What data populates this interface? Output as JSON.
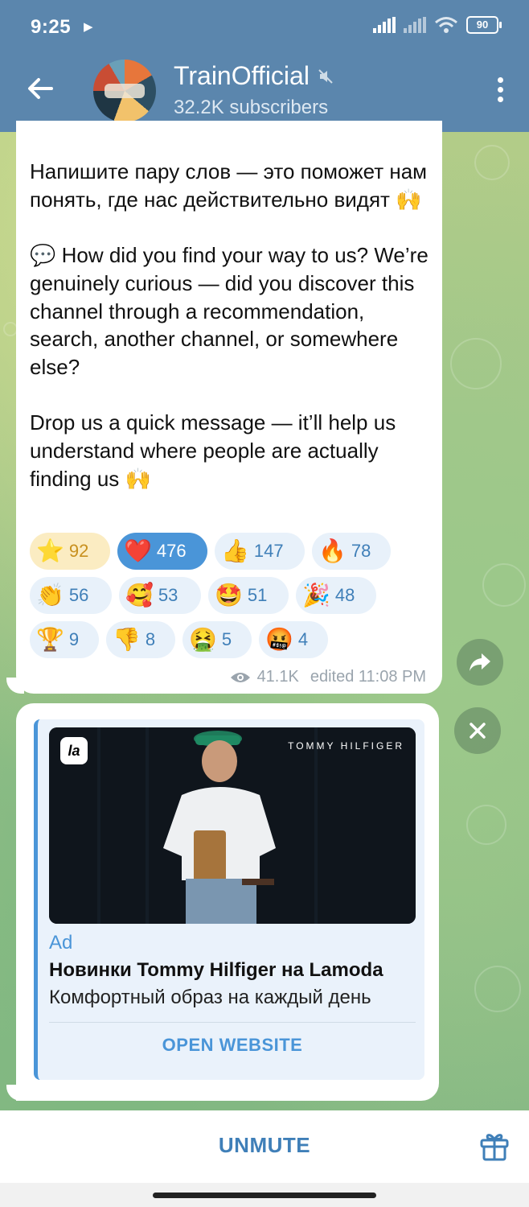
{
  "status_bar": {
    "time": "9:25",
    "battery": "90"
  },
  "header": {
    "title": "TrainOfficial",
    "subscribers": "32.2K subscribers"
  },
  "post": {
    "paragraphs": [
      "Напишите пару слов — это поможет нам понять, где нас действительно видят 🙌",
      "💬 How did you find your way to us? We’re genuinely curious — did you discover this channel through a recommendation, search, another channel, or somewhere else?",
      "Drop us a quick message — it’ll help us understand where people are actually finding us 🙌"
    ],
    "reactions": [
      {
        "emoji": "⭐",
        "count": "92"
      },
      {
        "emoji": "❤️",
        "count": "476"
      },
      {
        "emoji": "👍",
        "count": "147"
      },
      {
        "emoji": "🔥",
        "count": "78"
      },
      {
        "emoji": "👏",
        "count": "56"
      },
      {
        "emoji": "🥰",
        "count": "53"
      },
      {
        "emoji": "🤩",
        "count": "51"
      },
      {
        "emoji": "🎉",
        "count": "48"
      },
      {
        "emoji": "🏆",
        "count": "9"
      },
      {
        "emoji": "👎",
        "count": "8"
      },
      {
        "emoji": "🤮",
        "count": "5"
      },
      {
        "emoji": "🤬",
        "count": "4"
      }
    ],
    "views": "41.1K",
    "edited": "edited 11:08 PM"
  },
  "ad": {
    "logo": "la",
    "brand": "TOMMY HILFIGER",
    "label": "Ad",
    "title": "Новинки Tommy Hilfiger на Lamoda",
    "description": "Комфортный образ на каждый день",
    "button": "OPEN WEBSITE"
  },
  "bottom": {
    "action": "UNMUTE"
  },
  "colors": {
    "header": "#5b86ad",
    "accent": "#4a95d8",
    "reaction_bg": "#e8f1fa"
  },
  "icons": [
    "back-arrow-icon",
    "mute-icon",
    "more-vertical-icon",
    "share-icon",
    "close-icon",
    "eye-icon",
    "gift-icon"
  ]
}
